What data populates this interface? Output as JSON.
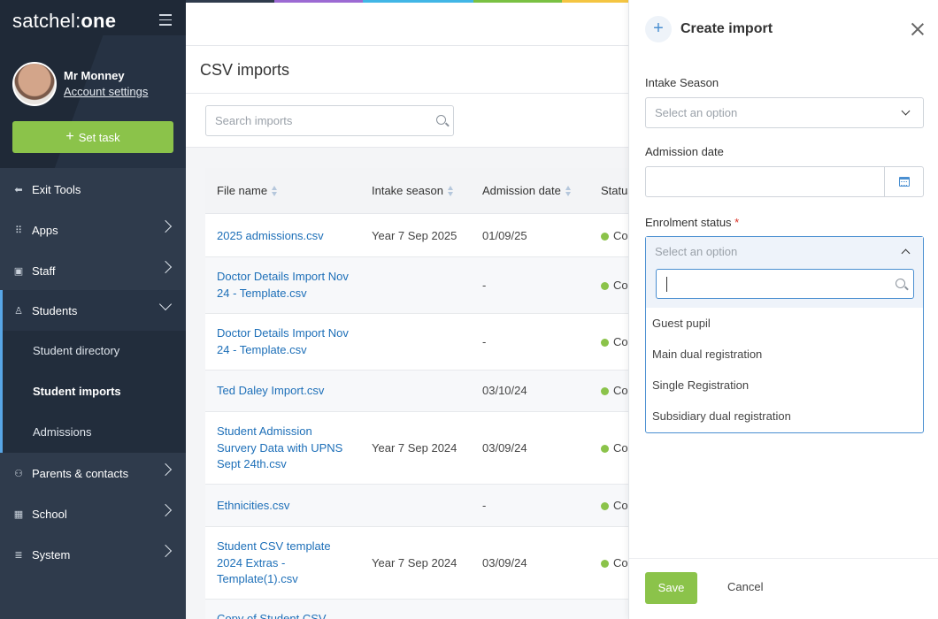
{
  "app": {
    "logo_light": "satchel",
    "logo_sep": ":",
    "logo_bold": "one"
  },
  "user": {
    "name": "Mr Monney",
    "account_link": "Account settings"
  },
  "sidebar": {
    "set_task_label": "Set task",
    "items": [
      {
        "label": "Exit Tools",
        "icon": "exit-icon"
      },
      {
        "label": "Apps",
        "icon": "apps-icon"
      },
      {
        "label": "Staff",
        "icon": "staff-icon"
      },
      {
        "label": "Students",
        "icon": "students-icon"
      },
      {
        "label": "Parents & contacts",
        "icon": "parents-icon"
      },
      {
        "label": "School",
        "icon": "school-icon"
      },
      {
        "label": "System",
        "icon": "system-icon"
      }
    ],
    "students_sub": [
      "Student directory",
      "Student imports",
      "Admissions"
    ]
  },
  "main": {
    "title": "CSV imports",
    "search_placeholder": "Search imports",
    "columns": [
      "File name",
      "Intake season",
      "Admission date",
      "Status"
    ],
    "rows": [
      {
        "file": "2025 admissions.csv",
        "season": "Year 7 Sep 2025",
        "date": "01/09/25",
        "status": "Co"
      },
      {
        "file": "Doctor Details Import Nov 24 - Template.csv",
        "season": "",
        "date": "-",
        "status": "Co"
      },
      {
        "file": "Doctor Details Import Nov 24 - Template.csv",
        "season": "",
        "date": "-",
        "status": "Co"
      },
      {
        "file": "Ted Daley Import.csv",
        "season": "",
        "date": "03/10/24",
        "status": "Co"
      },
      {
        "file": "Student Admission Survery Data with UPNS Sept 24th.csv",
        "season": "Year 7 Sep 2024",
        "date": "03/09/24",
        "status": "Co"
      },
      {
        "file": "Ethnicities.csv",
        "season": "",
        "date": "-",
        "status": "Co"
      },
      {
        "file": "Student CSV template 2024 Extras - Template(1).csv",
        "season": "Year 7 Sep 2024",
        "date": "03/09/24",
        "status": "Co"
      },
      {
        "file": "Copy of Student CSV",
        "season": "",
        "date": "",
        "status": ""
      }
    ]
  },
  "panel": {
    "title": "Create import",
    "intake_label": "Intake Season",
    "intake_placeholder": "Select an option",
    "admission_label": "Admission date",
    "enrolment_label": "Enrolment status",
    "required_mark": "*",
    "enrolment_placeholder": "Select an option",
    "options": [
      "Guest pupil",
      "Main dual registration",
      "Single Registration",
      "Subsidiary dual registration"
    ],
    "save_label": "Save",
    "cancel_label": "Cancel"
  },
  "colors": {
    "sidebar": "#2f3b4c",
    "accent_green": "#8bc34a",
    "link_blue": "#1d6fb8",
    "focus_blue": "#4a8fd1"
  }
}
